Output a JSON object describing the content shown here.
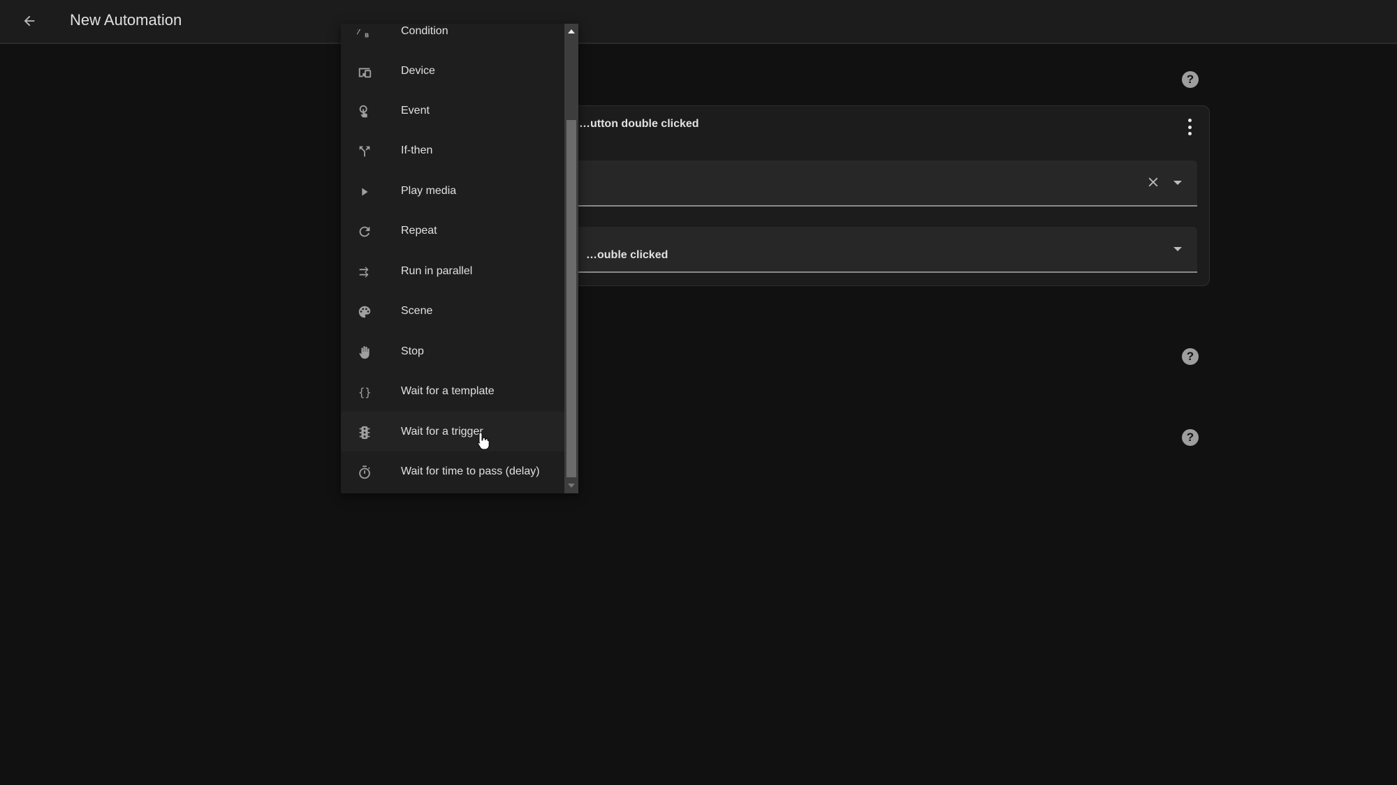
{
  "header": {
    "title": "New Automation",
    "back_icon": "arrow-left-icon"
  },
  "help_icons": [
    "help-circle-icon",
    "help-circle-icon",
    "help-circle-icon"
  ],
  "trigger_card": {
    "title": "…utton double clicked",
    "menu_icon": "dots-vertical-icon",
    "fields": [
      {
        "value": "",
        "clear_icon": "close-icon",
        "dropdown_icon": "menu-down-icon"
      },
      {
        "value": "…ouble clicked",
        "dropdown_icon": "menu-down-icon"
      }
    ]
  },
  "action_menu": {
    "hovered_index": 10,
    "items": [
      {
        "label": "Condition",
        "icon": "ab-testing-icon"
      },
      {
        "label": "Device",
        "icon": "devices-icon"
      },
      {
        "label": "Event",
        "icon": "gesture-tap-icon"
      },
      {
        "label": "If-then",
        "icon": "call-split-icon"
      },
      {
        "label": "Play media",
        "icon": "play-icon"
      },
      {
        "label": "Repeat",
        "icon": "refresh-icon"
      },
      {
        "label": "Run in parallel",
        "icon": "shuffle-disabled-icon"
      },
      {
        "label": "Scene",
        "icon": "palette-icon"
      },
      {
        "label": "Stop",
        "icon": "hand-back-right-icon"
      },
      {
        "label": "Wait for a template",
        "icon": "code-braces-icon"
      },
      {
        "label": "Wait for a trigger",
        "icon": "traffic-light-icon"
      },
      {
        "label": "Wait for time to pass (delay)",
        "icon": "timer-outline-icon"
      }
    ]
  },
  "colors": {
    "background": "#111111",
    "surface": "#1c1c1c",
    "menu": "#1e1e1e",
    "text": "#e1e1e1",
    "icon": "#a0a0a0"
  }
}
